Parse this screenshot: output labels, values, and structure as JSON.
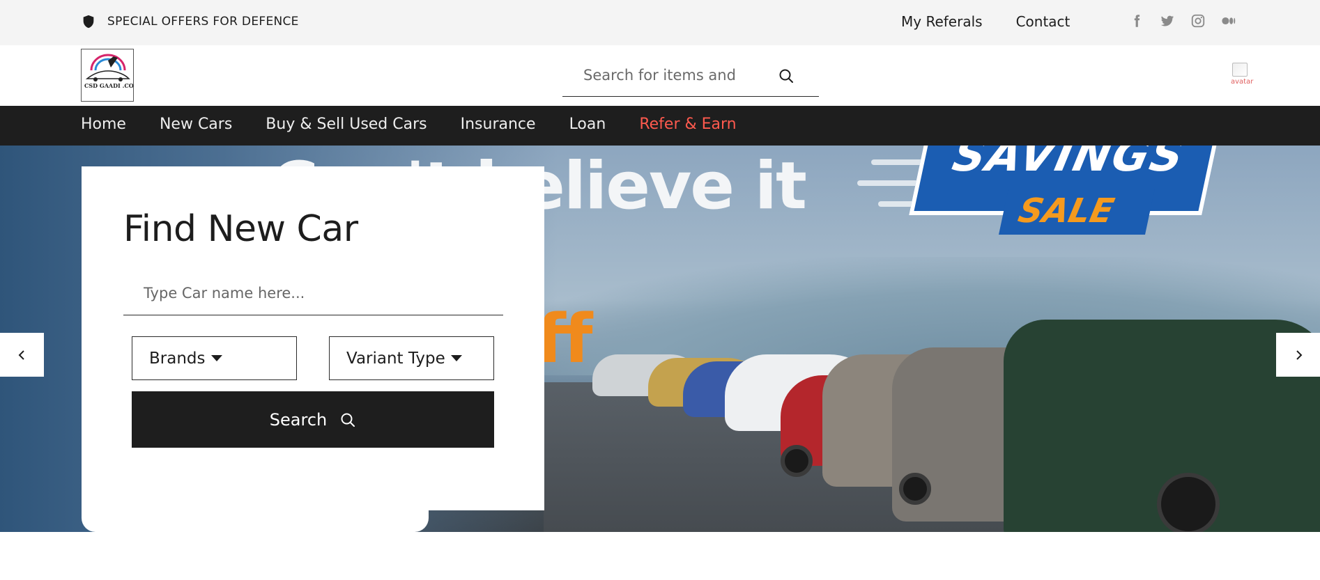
{
  "topbar": {
    "offer_text": "SPECIAL OFFERS FOR DEFENCE",
    "links": [
      "My Referals",
      "Contact"
    ],
    "social": [
      "facebook-icon",
      "twitter-icon",
      "instagram-icon",
      "medium-icon"
    ]
  },
  "header": {
    "search_placeholder": "Search for items and",
    "avatar_alt": "avatar",
    "logo_lines": [
      "CSD GAADI .COM"
    ]
  },
  "nav": {
    "items": [
      "Home",
      "New Cars",
      "Buy & Sell Used Cars",
      "Insurance",
      "Loan",
      "Refer & Earn"
    ],
    "accent_color": "#ff5a4e"
  },
  "hero": {
    "slogan": "Can't believe it",
    "off_text": "ff",
    "badge_top": "SAVINGS",
    "badge_bottom": "SALE"
  },
  "finder": {
    "title": "Find New Car",
    "car_name_placeholder": "Type Car name here...",
    "brands_label": "Brands",
    "variant_label": "Variant Type",
    "search_label": "Search"
  }
}
